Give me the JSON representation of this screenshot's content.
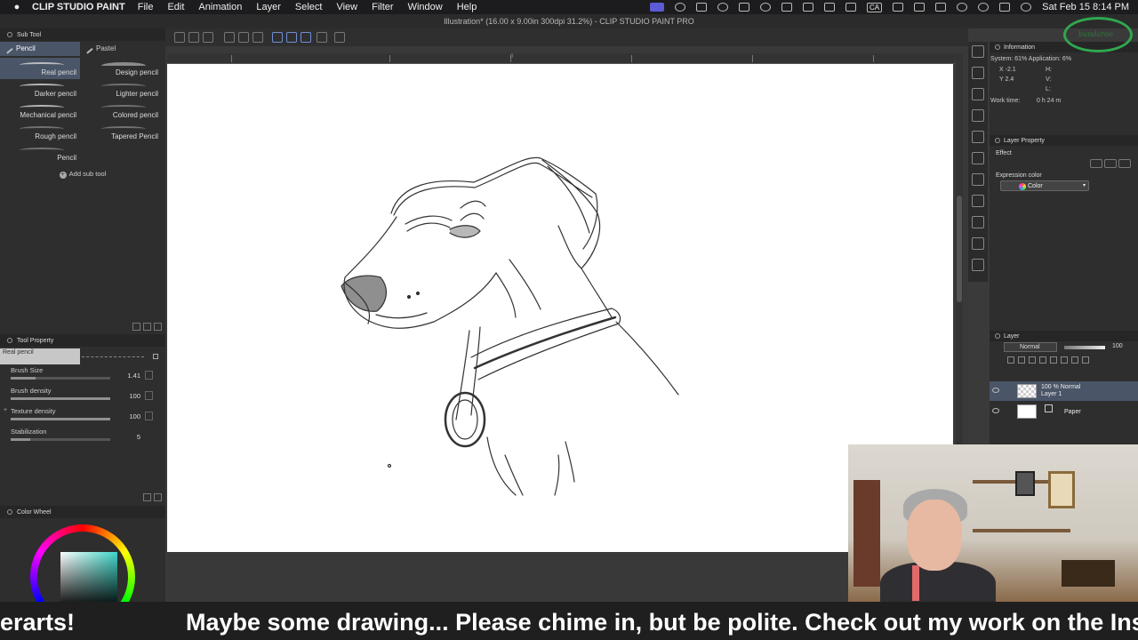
{
  "menubar": {
    "app_name": "CLIP STUDIO PAINT",
    "items": [
      "File",
      "Edit",
      "Animation",
      "Layer",
      "Select",
      "View",
      "Filter",
      "Window",
      "Help"
    ],
    "badge": "CA",
    "datetime": "Sat Feb 15  8:14 PM"
  },
  "window": {
    "title": "Illustration* (16.00 x 9.00in 300dpi 31.2%)  - CLIP STUDIO PAINT PRO"
  },
  "subtool": {
    "title": "Sub Tool",
    "tabs": [
      "Pencil",
      "Pastel"
    ],
    "brushes": [
      "Real pencil",
      "Design pencil",
      "Darker pencil",
      "Lighter pencil",
      "Mechanical pencil",
      "Colored pencil",
      "Rough pencil",
      "Tapered Pencil",
      "Pencil"
    ],
    "add_label": "Add sub tool"
  },
  "tool_property": {
    "title": "Tool Property",
    "brush_name": "Real pencil",
    "props": [
      {
        "label": "Brush Size",
        "value": "1.41",
        "fill": 0.25
      },
      {
        "label": "Brush density",
        "value": "100",
        "fill": 1.0
      },
      {
        "label": "Texture density",
        "value": "100",
        "fill": 1.0
      },
      {
        "label": "Stabilization",
        "value": "5",
        "fill": 0.2
      }
    ]
  },
  "color_wheel": {
    "title": "Color Wheel"
  },
  "ruler": {
    "label": "0"
  },
  "information": {
    "title": "Information",
    "system": "System:  61%  Application:  6%",
    "x": "X  -2.1",
    "y": "Y  2.4",
    "h": "H:",
    "v": "V:",
    "l": "L:",
    "work_time": "Work time:",
    "work_time_value": "0 h 24 m",
    "logo_text": "bundaroo"
  },
  "layer_property": {
    "title": "Layer Property",
    "effect_label": "Effect",
    "expression_label": "Expression color",
    "expression_value": "Color"
  },
  "layer": {
    "title": "Layer",
    "blend_mode": "Normal",
    "opacity": "100",
    "rows": [
      {
        "line1": "100 % Normal",
        "line2": "Layer 1"
      },
      {
        "name": "Paper"
      }
    ]
  },
  "ticker": {
    "left_text": "erarts!",
    "main_text": "Maybe some drawing... Please chime in, but be polite. Check out my work on the Ins"
  }
}
